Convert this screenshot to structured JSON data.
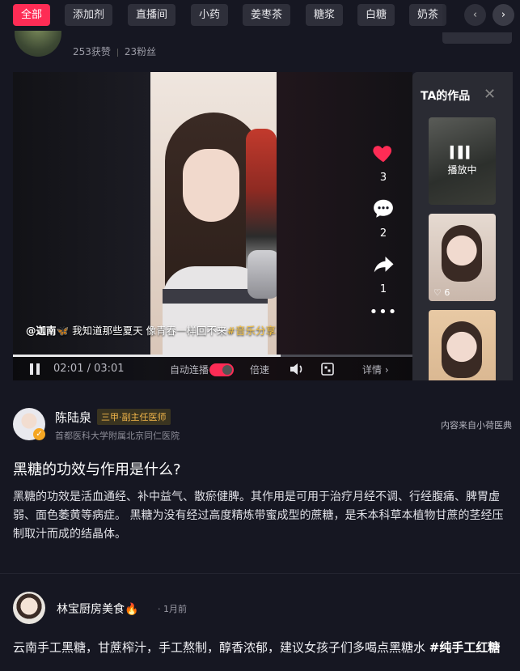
{
  "tags": {
    "items": [
      "全部",
      "添加剂",
      "直播间",
      "小药",
      "姜枣茶",
      "糖浆",
      "白糖",
      "奶茶"
    ],
    "prev_icon": "chevron-left-icon",
    "next_icon": "chevron-right-icon"
  },
  "author": {
    "likes": "253获赞",
    "fans": "23粉丝"
  },
  "video": {
    "caption_author": "@迦南🦋",
    "caption_text": "我知道那些夏天 像青春一样回不来",
    "caption_tag": "#音乐分享",
    "like_count": "3",
    "comment_count": "2",
    "share_count": "1",
    "time": "02:01 / 03:01",
    "progress_fraction": 0.67,
    "autoplay_label": "自动连播",
    "speed_label": "倍速",
    "detail_label": "详情",
    "accent_color": "#fe2c55"
  },
  "ta_panel": {
    "title": "TA的作品",
    "playing_label": "播放中",
    "thumb2_likes": "6"
  },
  "doctor": {
    "name": "陈陆泉",
    "badge": "三甲·副主任医师",
    "hospital": "首都医科大学附属北京同仁医院",
    "source": "内容来自小荷医典"
  },
  "qa": {
    "question": "黑糖的功效与作用是什么?",
    "answer": "黑糖的功效是活血通经、补中益气、散瘀健脾。其作用是可用于治疗月经不调、行经腹痛、脾胃虚弱、面色萎黄等病症。 黑糖为没有经过高度精炼带蜜成型的蔗糖，是禾本科草本植物甘蔗的茎经压制取汁而成的结晶体。"
  },
  "post": {
    "name": "林宝厨房美食🔥",
    "time": "1月前",
    "text": "云南手工黑糖，甘蔗榨汁，手工熬制，醇香浓郁，建议女孩子们多喝点黑糖水 ",
    "hashtag": "#纯手工红糖"
  }
}
